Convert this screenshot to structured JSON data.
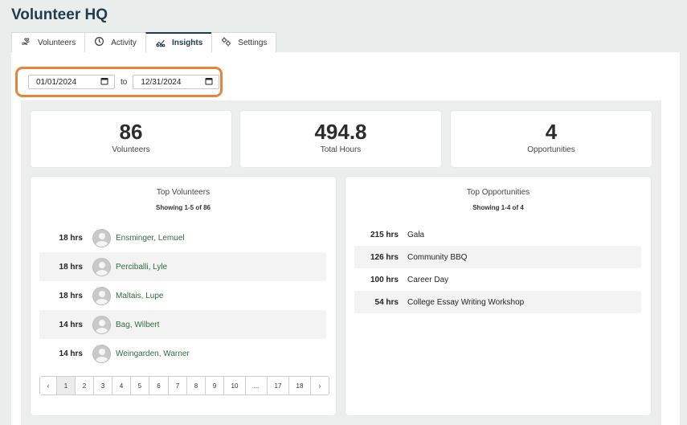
{
  "app": {
    "title": "Volunteer HQ"
  },
  "tabs": [
    {
      "label": "Volunteers",
      "icon": "hand-heart-icon"
    },
    {
      "label": "Activity",
      "icon": "clock-icon"
    },
    {
      "label": "Insights",
      "icon": "analytics-icon",
      "active": true
    },
    {
      "label": "Settings",
      "icon": "gears-icon"
    }
  ],
  "date_range": {
    "start": "01/01/2024",
    "separator": "to",
    "end": "12/31/2024"
  },
  "stats": [
    {
      "value": "86",
      "label": "Volunteers"
    },
    {
      "value": "494.8",
      "label": "Total Hours"
    },
    {
      "value": "4",
      "label": "Opportunities"
    }
  ],
  "top_volunteers": {
    "title": "Top Volunteers",
    "subtitle": "Showing 1-5 of 86",
    "rows": [
      {
        "hours": "18 hrs",
        "name": "Ensminger, Lemuel"
      },
      {
        "hours": "18 hrs",
        "name": "Perciballi, Lyle"
      },
      {
        "hours": "18 hrs",
        "name": "Maltais, Lupe"
      },
      {
        "hours": "14 hrs",
        "name": "Bag, Wilbert"
      },
      {
        "hours": "14 hrs",
        "name": "Weingarden, Warner"
      }
    ],
    "pagination": [
      "‹",
      "1",
      "2",
      "3",
      "4",
      "5",
      "6",
      "7",
      "8",
      "9",
      "10",
      "...",
      "17",
      "18",
      "›"
    ],
    "current_page": "1"
  },
  "top_opportunities": {
    "title": "Top Opportunities",
    "subtitle": "Showing 1-4 of 4",
    "rows": [
      {
        "hours": "215 hrs",
        "name": "Gala"
      },
      {
        "hours": "126 hrs",
        "name": "Community BBQ"
      },
      {
        "hours": "100 hrs",
        "name": "Career Day"
      },
      {
        "hours": "54 hrs",
        "name": "College Essay Writing Workshop"
      }
    ]
  },
  "colors": {
    "brand": "#1f3b4d",
    "highlight": "#e8833a",
    "link": "#2f6b3a"
  }
}
